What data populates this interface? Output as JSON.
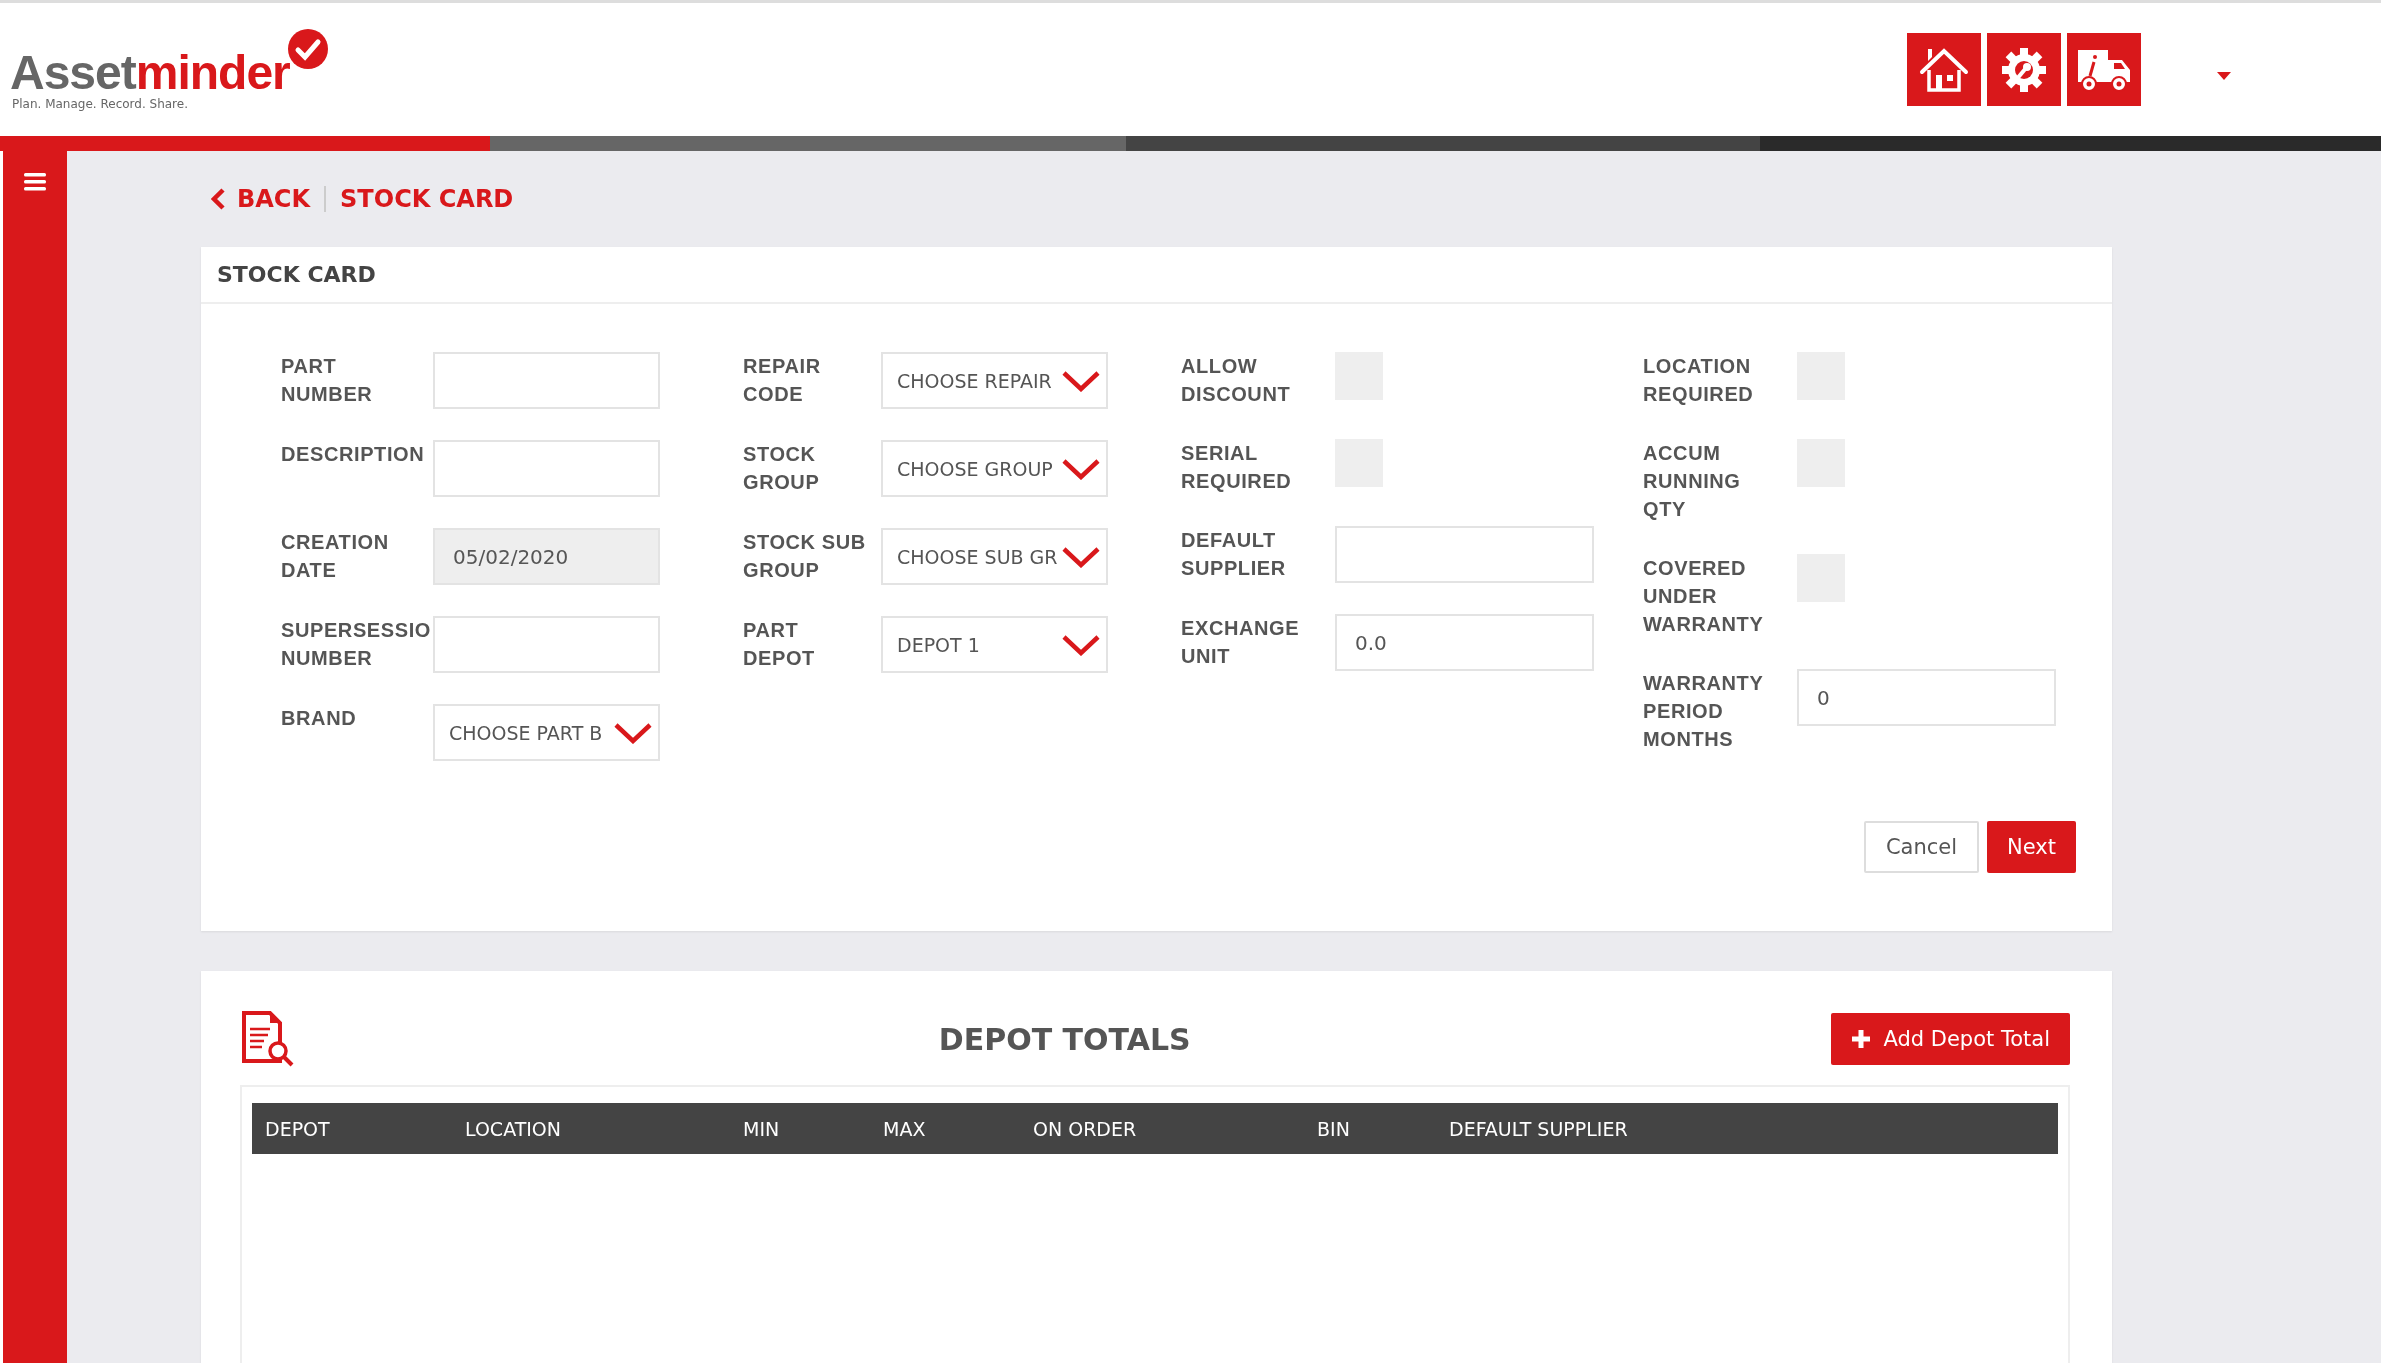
{
  "logo": {
    "name_part_1": "Asset",
    "name_part_2": "minder",
    "tagline": "Plan. Manage. Record. Share."
  },
  "header_buttons": [
    {
      "kind": "home"
    },
    {
      "kind": "settings"
    },
    {
      "kind": "truck"
    }
  ],
  "breadcrumb": {
    "back": "BACK",
    "current": "STOCK CARD"
  },
  "stock_card": {
    "title": "STOCK CARD",
    "columns": [
      [
        {
          "kind": "text",
          "label": "PART NUMBER"
        },
        {
          "kind": "text",
          "label": "DESCRIPTION"
        },
        {
          "kind": "text",
          "label": "CREATION DATE",
          "value": "05/02/2020",
          "disabled": true
        },
        {
          "kind": "text",
          "label": "SUPERSESSIO NUMBER"
        },
        {
          "kind": "select",
          "label": "BRAND",
          "value": "CHOOSE PART B"
        }
      ],
      [
        {
          "kind": "select",
          "label": "REPAIR CODE",
          "value": "CHOOSE REPAIR"
        },
        {
          "kind": "select",
          "label": "STOCK GROUP",
          "value": "CHOOSE GROUP"
        },
        {
          "kind": "select",
          "label": "STOCK SUB GROUP",
          "value": "CHOOSE SUB GR"
        },
        {
          "kind": "select",
          "label": "PART DEPOT",
          "value": "DEPOT 1"
        }
      ],
      [
        {
          "kind": "checkbox",
          "label": "ALLOW DISCOUNT",
          "checked": false
        },
        {
          "kind": "checkbox",
          "label": "SERIAL REQUIRED",
          "checked": false
        },
        {
          "kind": "text",
          "label": "DEFAULT SUPPLIER"
        },
        {
          "kind": "text",
          "label": "EXCHANGE UNIT",
          "value": "0.0"
        }
      ],
      [
        {
          "kind": "checkbox",
          "label": "LOCATION REQUIRED",
          "checked": false
        },
        {
          "kind": "checkbox",
          "label": "ACCUM RUNNING QTY",
          "checked": false
        },
        {
          "kind": "checkbox",
          "label": "COVERED UNDER WARRANTY",
          "checked": false
        },
        {
          "kind": "text",
          "label": "WARRANTY PERIOD MONTHS",
          "value": "0"
        }
      ]
    ],
    "buttons": [
      {
        "kind": "secondary",
        "label": "Cancel"
      },
      {
        "kind": "primary",
        "label": "Next"
      }
    ]
  },
  "depot_totals": {
    "title": "DEPOT TOTALS",
    "add_button": "Add Depot Total",
    "columns": [
      "DEPOT",
      "LOCATION",
      "MIN",
      "MAX",
      "ON ORDER",
      "BIN",
      "DEFAULT SUPPLIER"
    ]
  }
}
